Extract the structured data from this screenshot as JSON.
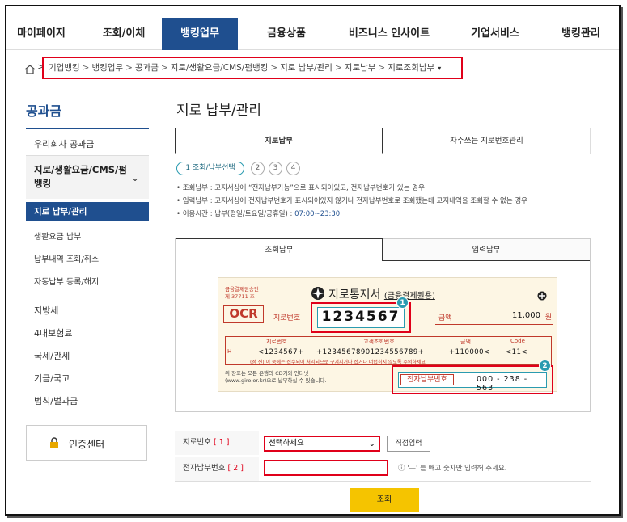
{
  "nav": {
    "items": [
      "마이페이지",
      "조회/이체",
      "뱅킹업무",
      "금융상품",
      "비즈니스 인사이트",
      "기업서비스",
      "뱅킹관리"
    ],
    "active_index": 2
  },
  "breadcrumb": {
    "items": [
      "기업뱅킹",
      "뱅킹업무",
      "공과금",
      "지로/생활요금/CMS/펌뱅킹",
      "지로 납부/관리",
      "지로납부",
      "지로조회납부"
    ],
    "separator": ">",
    "caret": "▾"
  },
  "sidebar": {
    "title": "공과금",
    "item_company_tax": "우리회사 공과금",
    "group_label": "지로/생활요금/CMS/펌뱅킹",
    "group_chevron": "⌄",
    "active_item": "지로 납부/관리",
    "sub_items": [
      "생활요금 납부",
      "납부내역 조회/취소",
      "자동납부 등록/해지"
    ],
    "items": [
      "지방세",
      "4대보험료",
      "국세/관세",
      "기금/국고",
      "범칙/벌과금"
    ],
    "cert_center": "인증센터"
  },
  "main": {
    "title": "지로 납부/관리",
    "tabs": [
      "지로납부",
      "자주쓰는 지로번호관리"
    ],
    "steps": {
      "active": "1 조회/납부선택",
      "others": [
        "2",
        "3",
        "4"
      ]
    },
    "info": [
      "• 조회납부 : 고지서상에 “전자납부가능”으로 표시되어있고, 전자납부번호가 있는 경우",
      "• 입력납부 : 고지서상에 전자납부번호가 표시되어있지 않거나 전자납부번호로 조회했는데 고지내역을 조회할 수 없는 경우"
    ],
    "hours_prefix": "• 이용시간 : 납부(평일/토요일/공휴일) : ",
    "hours_time": "07:00~23:30",
    "sub_tabs": [
      "조회납부",
      "입력납부"
    ]
  },
  "slip": {
    "corner_text_1": "금융결제원승인",
    "corner_text_2": "제 37711 호",
    "title": "지로통지서",
    "title_sub": "(금융결제원용)",
    "ocr": "OCR",
    "giro_label": "지로번호",
    "giro_number": "1234567",
    "amount_label": "금액",
    "amount": "11,000",
    "amount_unit": "원",
    "table_headers": [
      "지로번호",
      "고객조회번호",
      "금액",
      "Code"
    ],
    "table_h": "H",
    "table_values": [
      "<1234567+",
      "+12345678901234556789+",
      "+110000<",
      "<11<"
    ],
    "table_note": "(점 선) 이 중에는 접수되어 처리되므로 구겨지거나 접거나 더럽히지 않도록 주의하세요",
    "foot_1": "위 장표는 모든 은행의 CD기와 인터넷",
    "foot_2": "(www.giro.or.kr)으로 납부하실 수 있습니다.",
    "epay_label": "전자납부번호",
    "epay_number": "000 - 238 - 563",
    "badge_1": "1",
    "badge_2": "2"
  },
  "form": {
    "giro_label": "지로번호",
    "giro_req": "[ 1 ]",
    "select_value": "선택하세요",
    "direct_button": "직접입력",
    "epay_label": "전자납부번호",
    "epay_req": "[ 2 ]",
    "epay_value": "",
    "hint": "ⓘ '—' 를 빼고 숫자만 입력해 주세요.",
    "submit": "조회"
  },
  "colors": {
    "brand": "#1f4f8f",
    "highlight": "#e0001a",
    "accent": "#2a9bb0",
    "submit": "#f5c400",
    "slip_bg": "#fdf6e4"
  }
}
